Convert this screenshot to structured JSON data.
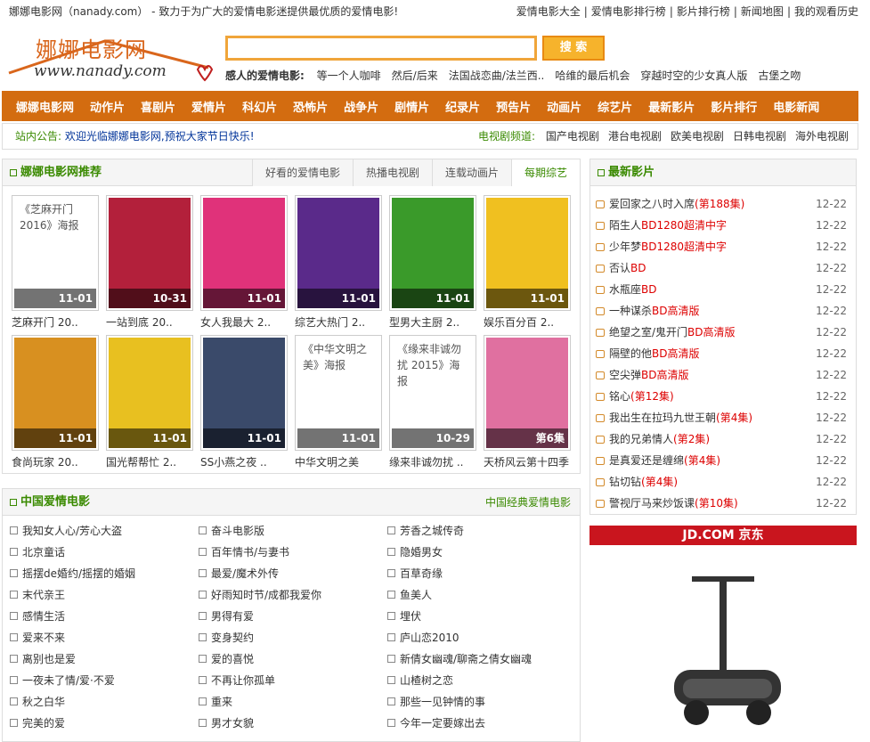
{
  "topbar": {
    "site_intro": "娜娜电影网（nanady.com） - 致力于为广大的爱情电影迷提供最优质的爱情电影!",
    "links": [
      "爱情电影大全",
      "爱情电影排行榜",
      "影片排行榜",
      "新闻地图",
      "我的观看历史"
    ]
  },
  "header": {
    "logo_cn": "娜娜电影网",
    "logo_en": "www.nanady.com",
    "search_value": "",
    "search_button": "搜 索",
    "hot_label": "感人的爱情电影:",
    "hot_items": [
      "等一个人咖啡",
      "然后/后来",
      "法国战恋曲/法兰西..",
      "哈维的最后机会",
      "穿越时空的少女真人版",
      "古堡之吻"
    ]
  },
  "nav": [
    "娜娜电影网",
    "动作片",
    "喜剧片",
    "爱情片",
    "科幻片",
    "恐怖片",
    "战争片",
    "剧情片",
    "纪录片",
    "预告片",
    "动画片",
    "综艺片",
    "最新影片",
    "影片排行",
    "电影新闻"
  ],
  "notice": {
    "label": "站内公告:",
    "text": "欢迎光临娜娜电影网,预祝大家节日快乐!",
    "tv_label": "电视剧频道:",
    "tv_links": [
      "国产电视剧",
      "港台电视剧",
      "欧美电视剧",
      "日韩电视剧",
      "海外电视剧"
    ]
  },
  "recommend": {
    "title": "娜娜电影网推荐",
    "tabs": [
      "好看的爱情电影",
      "热播电视剧",
      "连载动画片",
      "每期综艺"
    ],
    "active_tab": 3,
    "items": [
      {
        "name": "芝麻开门 20..",
        "date": "11-01",
        "alt": "《芝麻开门 2016》海报",
        "color": "#ffffff"
      },
      {
        "name": "一站到底 20..",
        "date": "10-31",
        "alt": "",
        "color": "#b3203b"
      },
      {
        "name": "女人我最大 2..",
        "date": "11-01",
        "alt": "",
        "color": "#e0327a"
      },
      {
        "name": "综艺大热门 2..",
        "date": "11-01",
        "alt": "",
        "color": "#5a2a8a"
      },
      {
        "name": "型男大主厨 2..",
        "date": "11-01",
        "alt": "",
        "color": "#3a9a2a"
      },
      {
        "name": "娱乐百分百 2..",
        "date": "11-01",
        "alt": "",
        "color": "#f0c020"
      },
      {
        "name": "食尚玩家 20..",
        "date": "11-01",
        "alt": "",
        "color": "#d89020"
      },
      {
        "name": "国光帮帮忙 2..",
        "date": "11-01",
        "alt": "",
        "color": "#e8c020"
      },
      {
        "name": "SS小燕之夜 ..",
        "date": "11-01",
        "alt": "",
        "color": "#3a4a6a"
      },
      {
        "name": "中华文明之美",
        "date": "11-01",
        "alt": "《中华文明之美》海报",
        "color": "#ffffff"
      },
      {
        "name": "缘来非诚勿扰 ..",
        "date": "10-29",
        "alt": "《缘来非诚勿扰 2015》海报",
        "color": "#ffffff"
      },
      {
        "name": "天桥风云第十四季",
        "date": "第6集",
        "alt": "",
        "color": "#e070a0"
      }
    ]
  },
  "latest": {
    "title": "最新影片",
    "items": [
      {
        "title": "爱回家之八时入席",
        "tag": "(第188集)",
        "date": "12-22"
      },
      {
        "title": "陌生人",
        "tag": "BD1280超清中字",
        "date": "12-22"
      },
      {
        "title": "少年梦",
        "tag": "BD1280超清中字",
        "date": "12-22"
      },
      {
        "title": "否认",
        "tag": "BD",
        "date": "12-22"
      },
      {
        "title": "水瓶座",
        "tag": "BD",
        "date": "12-22"
      },
      {
        "title": "一种谋杀",
        "tag": "BD高清版",
        "date": "12-22"
      },
      {
        "title": "绝望之室/鬼开门",
        "tag": "BD高清版",
        "date": "12-22"
      },
      {
        "title": "隔壁的他",
        "tag": "BD高清版",
        "date": "12-22"
      },
      {
        "title": "空尖弹",
        "tag": "BD高清版",
        "date": "12-22"
      },
      {
        "title": "铭心",
        "tag": "(第12集)",
        "date": "12-22"
      },
      {
        "title": "我出生在拉玛九世王朝",
        "tag": "(第4集)",
        "date": "12-22"
      },
      {
        "title": "我的兄弟情人",
        "tag": "(第2集)",
        "date": "12-22"
      },
      {
        "title": "是真爱还是缠绵",
        "tag": "(第4集)",
        "date": "12-22"
      },
      {
        "title": "钻切钻",
        "tag": "(第4集)",
        "date": "12-22"
      },
      {
        "title": "警视厅马来炒饭课",
        "tag": "(第10集)",
        "date": "12-22"
      }
    ]
  },
  "china": {
    "title": "中国爱情电影",
    "more": "中国经典爱情电影",
    "col1": [
      "我知女人心/芳心大盗",
      "北京童话",
      "摇摆de婚约/摇摆的婚姻",
      "末代亲王",
      "感情生活",
      "爱来不来",
      "离别也是爱",
      "一夜未了情/爱·不爱",
      "秋之白华",
      "完美的爱"
    ],
    "col2": [
      "奋斗电影版",
      "百年情书/与妻书",
      "最爱/魔术外传",
      "好雨知时节/成都我爱你",
      "男得有爱",
      "变身契约",
      "爱的喜悦",
      "不再让你孤单",
      "重来",
      "男才女貌"
    ],
    "col3": [
      "芳香之城传奇",
      "隐婚男女",
      "百草奇缘",
      "鱼美人",
      "埋伏",
      "庐山恋2010",
      "新倩女幽魂/聊斋之倩女幽魂",
      "山楂树之恋",
      "那些一见钟情的事",
      "今年一定要嫁出去"
    ]
  },
  "ad": {
    "brand": "JD.COM 京东"
  }
}
